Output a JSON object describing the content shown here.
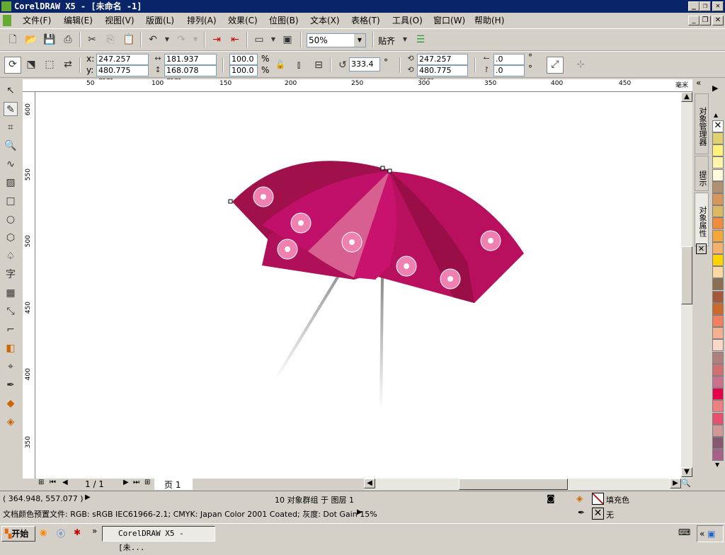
{
  "window": {
    "title": "CorelDRAW X5 - [未命名 -1]",
    "min": "_",
    "restore": "❐",
    "close": "✕"
  },
  "menu": [
    "文件(F)",
    "编辑(E)",
    "视图(V)",
    "版面(L)",
    "排列(A)",
    "效果(C)",
    "位图(B)",
    "文本(X)",
    "表格(T)",
    "工具(O)",
    "窗口(W)",
    "帮助(H)"
  ],
  "toolbar": {
    "zoom": "50%",
    "snap": "贴齐"
  },
  "props": {
    "x": "247.257 mm",
    "y": "480.775 mm",
    "w": "181.937 mm",
    "h": "168.078 mm",
    "sx": "100.0",
    "sy": "100.0",
    "pct": "%",
    "angle": "333.4",
    "deg": "°",
    "cx": "247.257 mm",
    "cy": "480.775 mm",
    "ox": ".0",
    "oy": ".0",
    "x_label": "x:",
    "y_label": "y:"
  },
  "ruler": {
    "h": [
      "50",
      "100",
      "150",
      "200",
      "250",
      "300",
      "350",
      "400",
      "450"
    ],
    "unit": "毫米",
    "v": [
      "600",
      "550",
      "500",
      "450",
      "400",
      "350"
    ]
  },
  "dockers": [
    "对象管理器",
    "提示",
    "对象属性"
  ],
  "page_nav": {
    "count": "1 / 1",
    "tab": "页 1"
  },
  "status": {
    "coords": "( 364.948, 557.077 )",
    "selection": "10 对象群组 于 图层 1",
    "profile": "文档颜色预置文件: RGB: sRGB IEC61966-2.1; CMYK: Japan Color 2001 Coated; 灰度: Dot Gain 15%",
    "fill": "填充色",
    "outline": "无"
  },
  "taskbar": {
    "start": "开始",
    "task": "CorelDRAW X5 - [未..."
  },
  "palette": [
    "#e0d070",
    "#fff27a",
    "#fff5a8",
    "#fffbdc",
    "#b09070",
    "#d8965a",
    "#dcb860",
    "#f08a3c",
    "#f5a83a",
    "#f5b06a",
    "#ffd200",
    "#fcd8a0",
    "#8a7050",
    "#a8583a",
    "#cc6a2a",
    "#f08060",
    "#f5b090",
    "#fad8c8",
    "#b08080",
    "#d07070",
    "#cc7090",
    "#e8004a",
    "#f08080",
    "#e85070",
    "#d09898",
    "#885870",
    "#a86088"
  ],
  "colors": {
    "umbrella_dark": "#a0104a",
    "umbrella_mid": "#c0106a",
    "umbrella_light": "#d86090",
    "flower": "#f080b0"
  }
}
